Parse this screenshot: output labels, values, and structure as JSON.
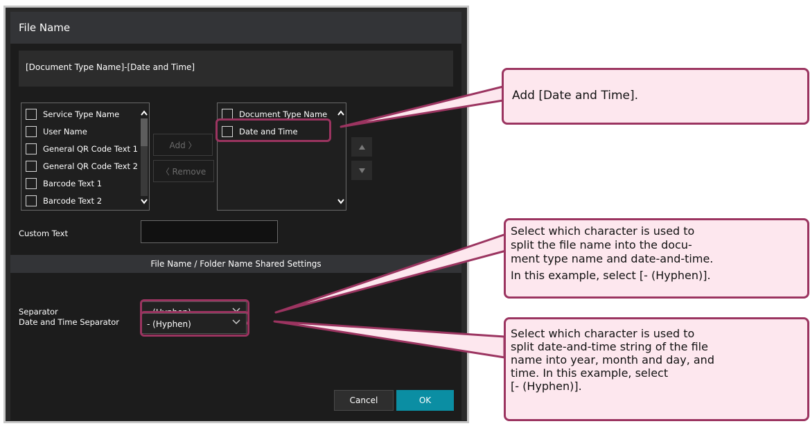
{
  "dialog": {
    "title": "File Name",
    "preview_text": "[Document Type Name]-[Date and Time]",
    "available_items": [
      "Service Type Name",
      "User Name",
      "General QR Code Text 1",
      "General QR Code Text 2",
      "Barcode Text 1",
      "Barcode Text 2"
    ],
    "selected_items": [
      "Document Type Name",
      "Date and Time"
    ],
    "add_label": "Add  〉",
    "remove_label": "〈  Remove",
    "custom_text_label": "Custom Text",
    "custom_text_value": "",
    "section_title": "File Name / Folder Name Shared Settings",
    "separator_label": "Separator",
    "separator_value": "- (Hyphen)",
    "date_time_separator_label": "Date and Time Separator",
    "date_time_separator_value": "- (Hyphen)",
    "cancel_label": "Cancel",
    "ok_label": "OK"
  },
  "callouts": {
    "add_datetime": "Add [Date and Time].",
    "separator_line1": "Select which character is used to",
    "separator_line2": "split the file name into the docu-",
    "separator_line3": "ment type name and date-and-time.",
    "separator_line4": "In this example, select [- (Hyphen)].",
    "dt_separator_line1": "Select which character is used to",
    "dt_separator_line2": "split date-and-time string of the file",
    "dt_separator_line3": "name into year, month and day, and",
    "dt_separator_line4": "time. In this example, select",
    "dt_separator_line5": "[- (Hyphen)]."
  },
  "colors": {
    "dialog_bg": "#1c1c1c",
    "accent_ok": "#0b8ea3",
    "highlight": "#9b3460",
    "callout_bg": "#fde7ee"
  },
  "icons": [
    "chevron-up-icon",
    "chevron-down-icon",
    "triangle-up-icon",
    "triangle-down-icon",
    "dropdown-chevron-icon"
  ]
}
